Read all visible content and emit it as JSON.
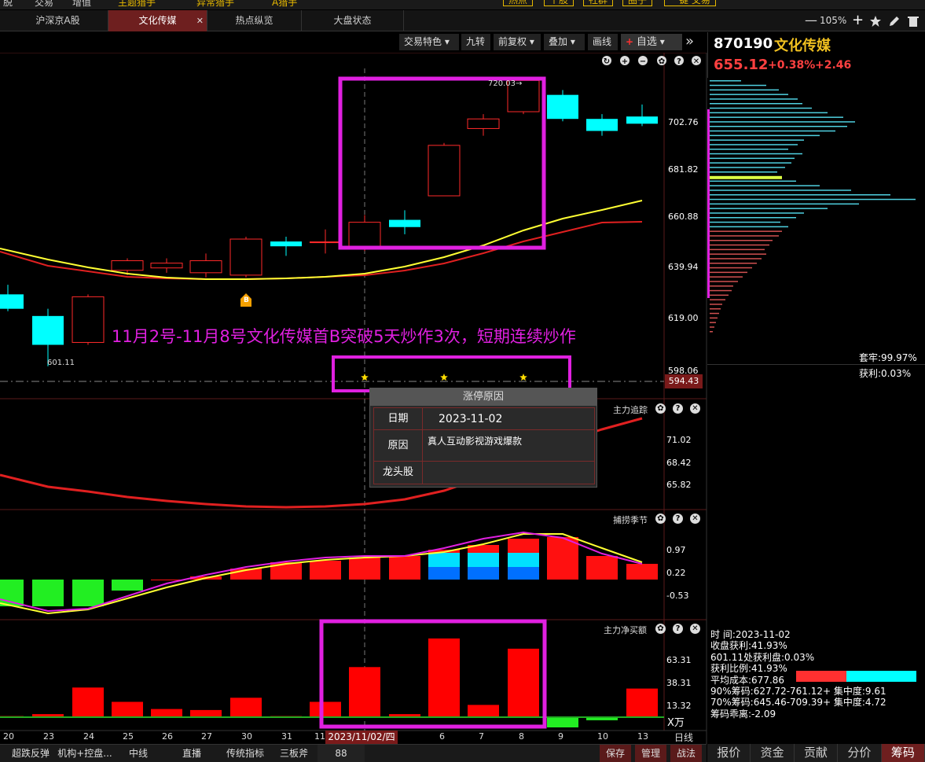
{
  "topbar": {
    "items": [
      "脱",
      "交易",
      "增值",
      "主题猎手",
      "异常猎手",
      "A猎手",
      "热点",
      "个股",
      "社群",
      "圈子",
      "一键 交易"
    ]
  },
  "tabs": [
    {
      "label": "沪深京A股",
      "active": false
    },
    {
      "label": "文化传媒",
      "active": true,
      "closable": true,
      "close": "✕"
    },
    {
      "label": "热点纵览",
      "active": false
    },
    {
      "label": "大盘状态",
      "active": false
    }
  ],
  "window": {
    "zoom": "105%",
    "minus": "—",
    "plus": "+"
  },
  "toolbar": {
    "items": [
      "交易特色",
      "九转",
      "前复权",
      "叠加",
      "画线",
      "自选"
    ],
    "more": "»"
  },
  "stock": {
    "code": "870190",
    "name": "文化传媒",
    "price": "655.12",
    "pct": "+0.38%",
    "change": "+2.46"
  },
  "main_chart": {
    "price_labels": [
      "702.76",
      "681.82",
      "660.88",
      "639.94",
      "619.00",
      "598.06"
    ],
    "current_price_tag": "594.43",
    "high_label": "720.03→",
    "low_label": "601.11",
    "b_marker": "B",
    "annotation": "11月2号-11月8号文化传媒首B突破5天炒作3次，短期连续炒作",
    "chip_trap": "套牢:99.97%",
    "chip_profit": "获利:0.03%"
  },
  "popup": {
    "title": "涨停原因",
    "date_label": "日期",
    "date_value": "2023-11-02",
    "reason_label": "原因",
    "reason_value": "真人互动影视游戏爆款",
    "leader_label": "龙头股",
    "leader_value": ""
  },
  "panel1": {
    "title": "主力追踪",
    "labels": [
      "71.02",
      "68.42",
      "65.82"
    ]
  },
  "panel2": {
    "title": "捕捞季节",
    "labels": [
      "0.97",
      "0.22",
      "-0.53"
    ]
  },
  "panel3": {
    "title": "主力净买额",
    "labels": [
      "63.31",
      "38.31",
      "13.32"
    ],
    "unit": "X万"
  },
  "xaxis": {
    "dates": [
      "20",
      "23",
      "24",
      "25",
      "26",
      "27",
      "30",
      "31",
      "11",
      "6",
      "7",
      "8",
      "9",
      "10",
      "13"
    ],
    "cursor_date": "2023/11/02/四",
    "period": "日线"
  },
  "chip_stats": {
    "time": "时        间:2023-11-02",
    "profit": "收盘获利:41.93%",
    "at_price": "601.11处获利盘:0.03%",
    "ratio": "获利比例:41.93%",
    "avg": "平均成本:677.86",
    "c90": "90%筹码:627.72-761.12+ 集中度:9.61",
    "c70": "70%筹码:645.46-709.39+ 集中度:4.72",
    "dev": "筹码乖离:-2.09",
    "ratio_value": 0.4193
  },
  "right_tabs": [
    "报价",
    "资金",
    "贡献",
    "分价",
    "筹码"
  ],
  "bottombar": {
    "items": [
      "超跌反弹",
      "机构+控盘...",
      "中线",
      "直播",
      "传统指标",
      "三板斧",
      "88"
    ],
    "actions": [
      "保存",
      "管理",
      "战法"
    ]
  },
  "colors": {
    "up": "#ff2a2a",
    "down": "#00ffff",
    "ma_yellow": "#ffff33",
    "ma_red": "#e02020",
    "highlight": "#e020e0",
    "chip_cyan": "#4fd0e0",
    "chip_red": "#d05050"
  },
  "icons": [
    "refresh-icon",
    "zoom-in-icon",
    "zoom-out-icon",
    "gear-icon",
    "help-icon",
    "close-icon",
    "star-icon"
  ]
}
